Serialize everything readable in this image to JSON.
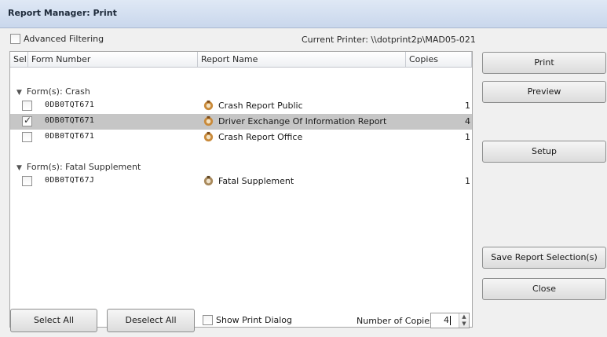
{
  "window": {
    "title": "Report Manager: Print"
  },
  "filter": {
    "advanced_label": "Advanced Filtering",
    "advanced_checked": false
  },
  "printer": {
    "label": "Current Printer: \\\\dotprint2p\\MAD05-021"
  },
  "grid": {
    "columns": [
      "Sel...",
      "Form Number",
      "Report Name",
      "Copies"
    ],
    "groups": [
      {
        "label": "Form(s): Crash",
        "rows": [
          {
            "selected": false,
            "form_number": "0DB0TQT671",
            "icon": "report-icon",
            "report_name": "Crash Report Public",
            "copies": "1"
          },
          {
            "selected": true,
            "form_number": "0DB0TQT671",
            "icon": "report-icon",
            "report_name": "Driver Exchange Of Information Report",
            "copies": "4"
          },
          {
            "selected": false,
            "form_number": "0DB0TQT671",
            "icon": "report-icon",
            "report_name": "Crash Report Office",
            "copies": "1"
          }
        ]
      },
      {
        "label": "Form(s): Fatal Supplement",
        "rows": [
          {
            "selected": false,
            "form_number": "0DB0TQT67J",
            "icon": "report-icon",
            "report_name": "Fatal Supplement",
            "copies": "1"
          }
        ]
      }
    ]
  },
  "buttons": {
    "print": "Print",
    "preview": "Preview",
    "setup": "Setup",
    "save_selection": "Save Report Selection(s)",
    "close": "Close",
    "select_all": "Select All",
    "deselect_all": "Deselect All"
  },
  "bottom": {
    "show_print_dialog_label": "Show Print Dialog",
    "show_print_dialog_checked": false,
    "number_of_copies_label": "Number of Copies",
    "number_of_copies_value": "4"
  },
  "colors": {
    "selected_row": "#c6c6c6",
    "titlebar": "#c9d7ec"
  }
}
